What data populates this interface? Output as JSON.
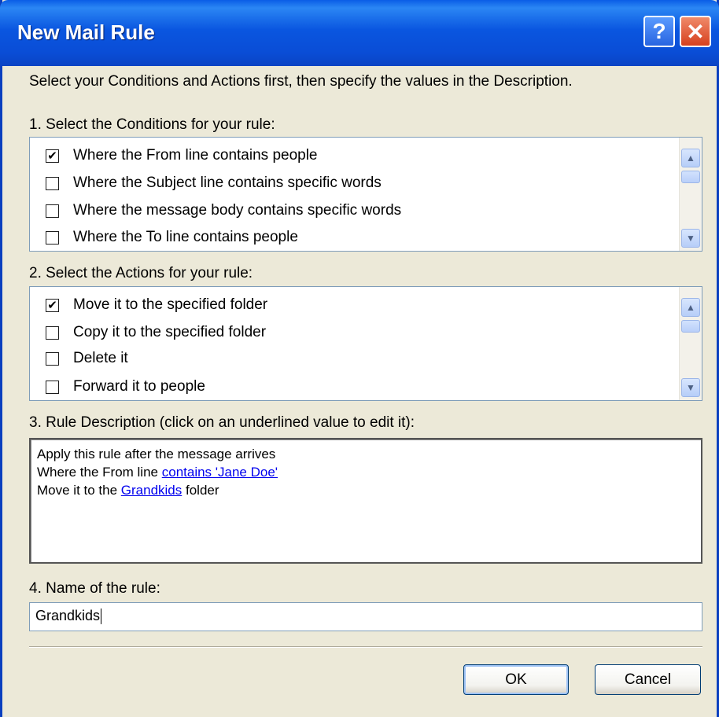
{
  "window": {
    "title": "New Mail Rule",
    "help_glyph": "?",
    "close_glyph": "✕"
  },
  "intro": "Select your Conditions and Actions first, then specify the values in the Description.",
  "conditions": {
    "label": "1. Select the Conditions for your rule:",
    "items": [
      {
        "label": "Where the From line contains people",
        "checked": true
      },
      {
        "label": "Where the Subject line contains specific words",
        "checked": false
      },
      {
        "label": "Where the message body contains specific words",
        "checked": false
      },
      {
        "label": "Where the To line contains people",
        "checked": false
      }
    ]
  },
  "actions": {
    "label": "2. Select the Actions for your rule:",
    "items": [
      {
        "label": "Move it to the specified folder",
        "checked": true
      },
      {
        "label": "Copy it to the specified folder",
        "checked": false
      },
      {
        "label": "Delete it",
        "checked": false
      },
      {
        "label": "Forward it to people",
        "checked": false
      }
    ]
  },
  "description": {
    "label": "3. Rule Description (click on an underlined value to edit it):",
    "line1": "Apply this rule after the message arrives",
    "line2_prefix": "Where the From line ",
    "line2_link": "contains 'Jane Doe'",
    "line3_prefix": "Move it to the ",
    "line3_link": "Grandkids",
    "line3_suffix": " folder"
  },
  "name": {
    "label": "4. Name of the rule:",
    "value": "Grandkids"
  },
  "buttons": {
    "ok": "OK",
    "cancel": "Cancel"
  },
  "colors": {
    "titlebar": "#0a56e0",
    "link": "#0000ee",
    "dialog_bg": "#ece9d8"
  }
}
